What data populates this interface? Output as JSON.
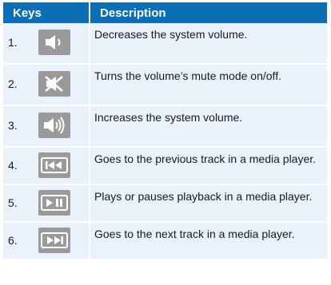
{
  "header": {
    "keys": "Keys",
    "description": "Description"
  },
  "rows": [
    {
      "num": "1.",
      "icon": "volume-down-icon",
      "desc": "Decreases the system volume."
    },
    {
      "num": "2.",
      "icon": "mute-icon",
      "desc": "Turns the volume’s mute mode on/off."
    },
    {
      "num": "3.",
      "icon": "volume-up-icon",
      "desc": "Increases the system volume."
    },
    {
      "num": "4.",
      "icon": "previous-track-icon",
      "desc": "Goes to the previous track in a media player."
    },
    {
      "num": "5.",
      "icon": "play-pause-icon",
      "desc": "Plays or pauses playback in a media player."
    },
    {
      "num": "6.",
      "icon": "next-track-icon",
      "desc": "Goes to the next track in a media player."
    }
  ],
  "colors": {
    "header_bg": "#0a6fb7",
    "row_bg": "#e9f2fa",
    "key_bg": "#9a9a9a"
  }
}
